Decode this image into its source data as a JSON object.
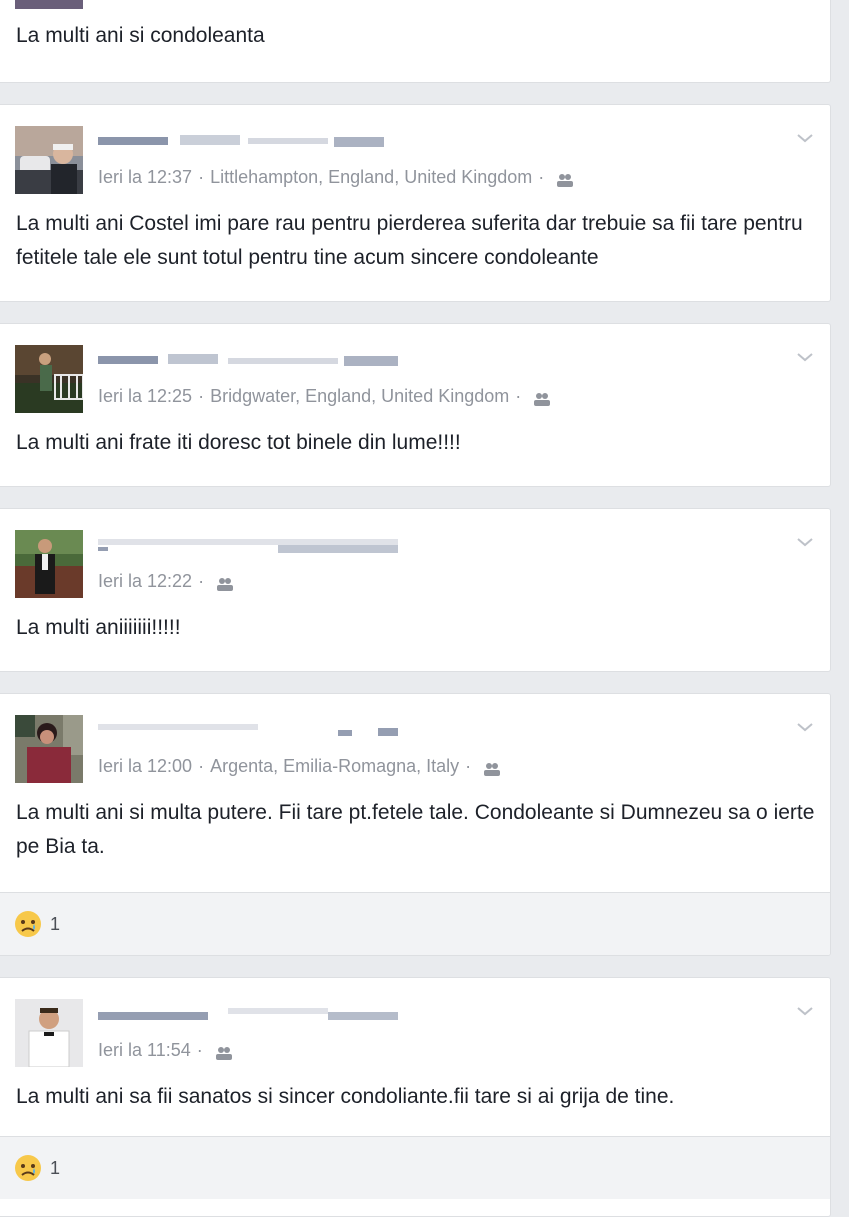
{
  "feed": {
    "top_comment": {
      "text": "La multi ani si condoleanta"
    },
    "posts": [
      {
        "time": "Ieri la 12:37",
        "location": "Littlehampton, England, United Kingdom",
        "text": "La multi ani Costel imi pare rau pentru pierderea suferita dar trebuie sa fii tare pentru fetitele tale ele sunt totul pentru tine acum sincere condoleante"
      },
      {
        "time": "Ieri la 12:25",
        "location": "Bridgwater, England, United Kingdom",
        "text": "La multi ani frate iti doresc tot binele din lume!!!!"
      },
      {
        "time": "Ieri la 12:22",
        "location": "",
        "text": "La multi aniiiiiii!!!!!"
      },
      {
        "time": "Ieri la 12:00",
        "location": "Argenta, Emilia-Romagna, Italy",
        "text": "La multi ani si multa putere. Fii tare pt.fetele tale. Condoleante si Dumnezeu sa o ierte pe Bia ta.",
        "reaction_count": "1"
      },
      {
        "time": "Ieri la 11:54",
        "location": "",
        "text": "La multi ani sa fii sanatos si sincer condoliante.fii tare si ai grija de tine.",
        "reaction_count": "1"
      }
    ],
    "separator": "·"
  },
  "icons": {
    "audience": "friends-audience-icon",
    "menu": "chevron-down-icon",
    "reaction": "sad-reaction-icon"
  },
  "colors": {
    "background": "#e9ebee",
    "meta_text": "#90949c",
    "body_text": "#1d2129",
    "reaction_bar": "#f2f3f5"
  }
}
